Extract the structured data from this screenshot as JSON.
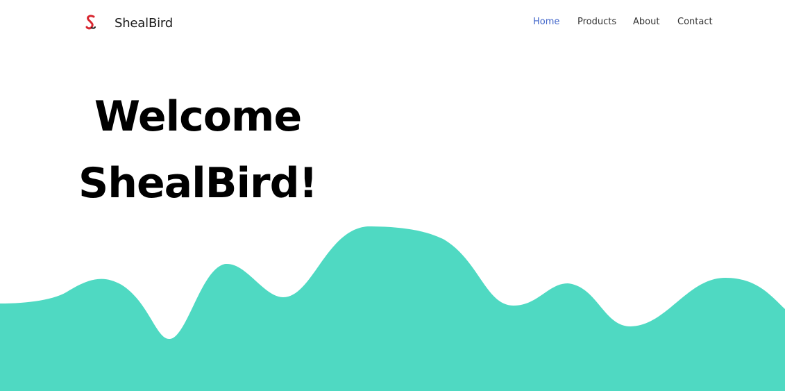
{
  "brand": {
    "name": "ShealBird",
    "logo_icon": "s-bird-logo",
    "logo_colors": [
      "#d8262f",
      "#222222"
    ]
  },
  "nav": {
    "items": [
      {
        "label": "Home",
        "active": true
      },
      {
        "label": "Products",
        "active": false
      },
      {
        "label": "About",
        "active": false
      },
      {
        "label": "Contact",
        "active": false
      }
    ]
  },
  "hero": {
    "line1": "Welcome",
    "line2": "ShealBird!"
  },
  "colors": {
    "accent": "#3e63c9",
    "wave": "#4fd9c2",
    "text": "#000000",
    "background": "#ffffff"
  }
}
